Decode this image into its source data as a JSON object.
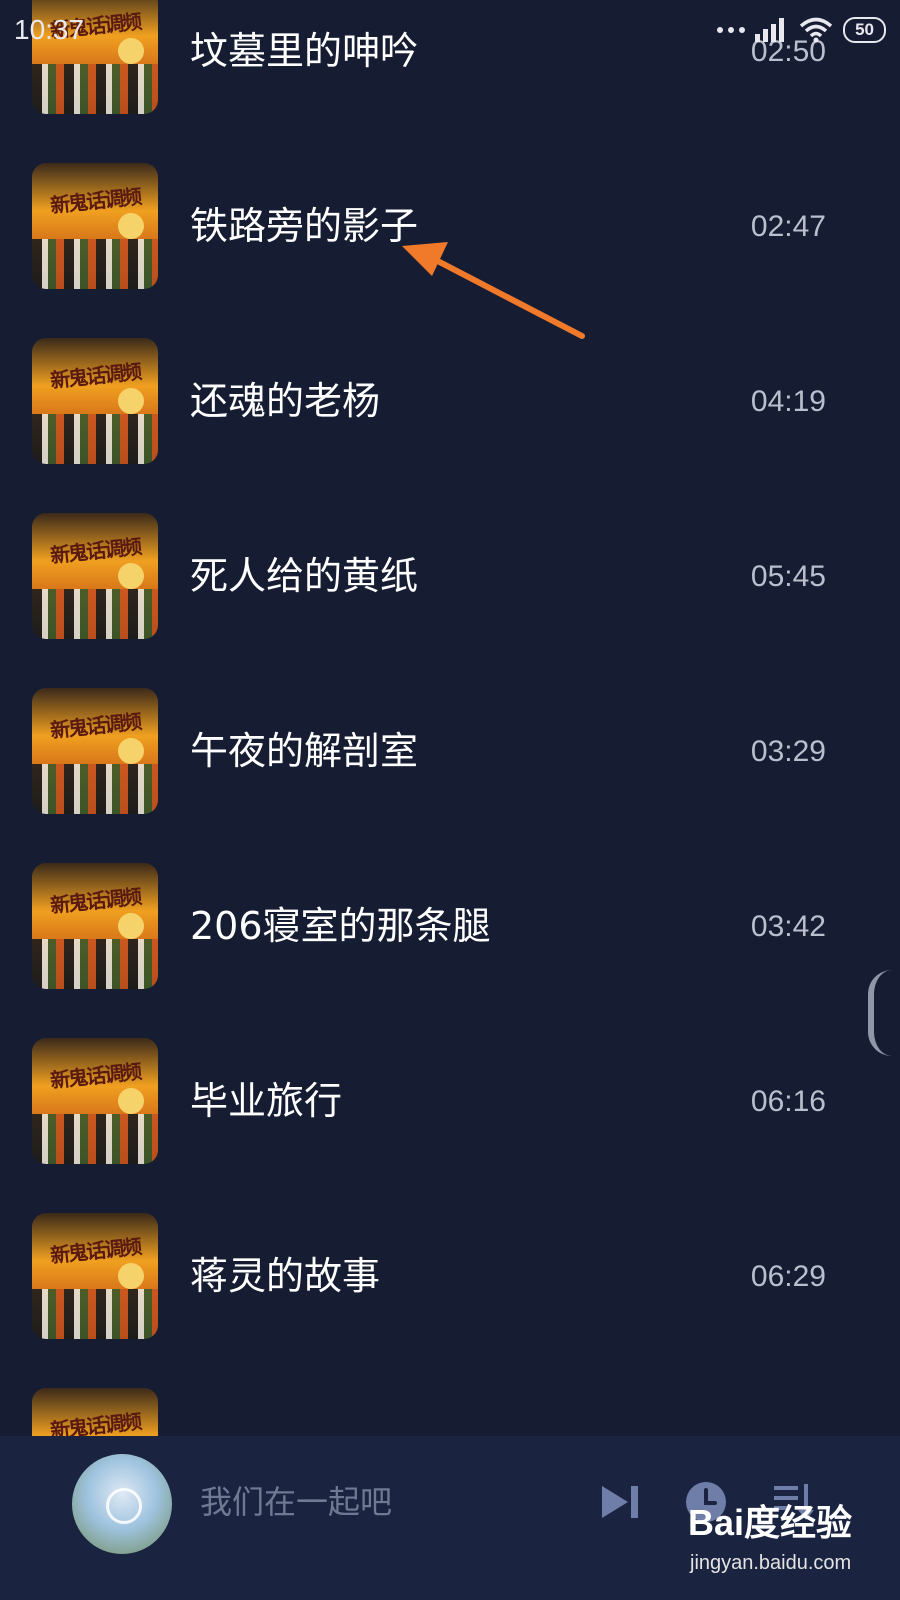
{
  "status_bar": {
    "time": "10:37",
    "battery": "50"
  },
  "tracks": [
    {
      "title": "坟墓里的呻吟",
      "duration": "02:50"
    },
    {
      "title": "铁路旁的影子",
      "duration": "02:47"
    },
    {
      "title": "还魂的老杨",
      "duration": "04:19"
    },
    {
      "title": "死人给的黄纸",
      "duration": "05:45"
    },
    {
      "title": "午夜的解剖室",
      "duration": "03:29"
    },
    {
      "title": "206寝室的那条腿",
      "duration": "03:42"
    },
    {
      "title": "毕业旅行",
      "duration": "06:16"
    },
    {
      "title": "蒋灵的故事",
      "duration": "06:29"
    },
    {
      "title": "",
      "duration": ""
    }
  ],
  "cover_art_text": "新鬼话调频",
  "player": {
    "now_playing": "我们在一起吧",
    "controls": [
      "next-icon",
      "timer-clock-icon",
      "playlist-queue-icon"
    ]
  },
  "watermark": {
    "brand": "Bai度经验",
    "url": "jingyan.baidu.com"
  },
  "annotation": {
    "color": "#f07a2a"
  },
  "colors": {
    "background": "#161d33",
    "player_bar": "#1a2340",
    "duration_text": "#b9bfcc",
    "now_playing_text": "#6f7a92"
  }
}
